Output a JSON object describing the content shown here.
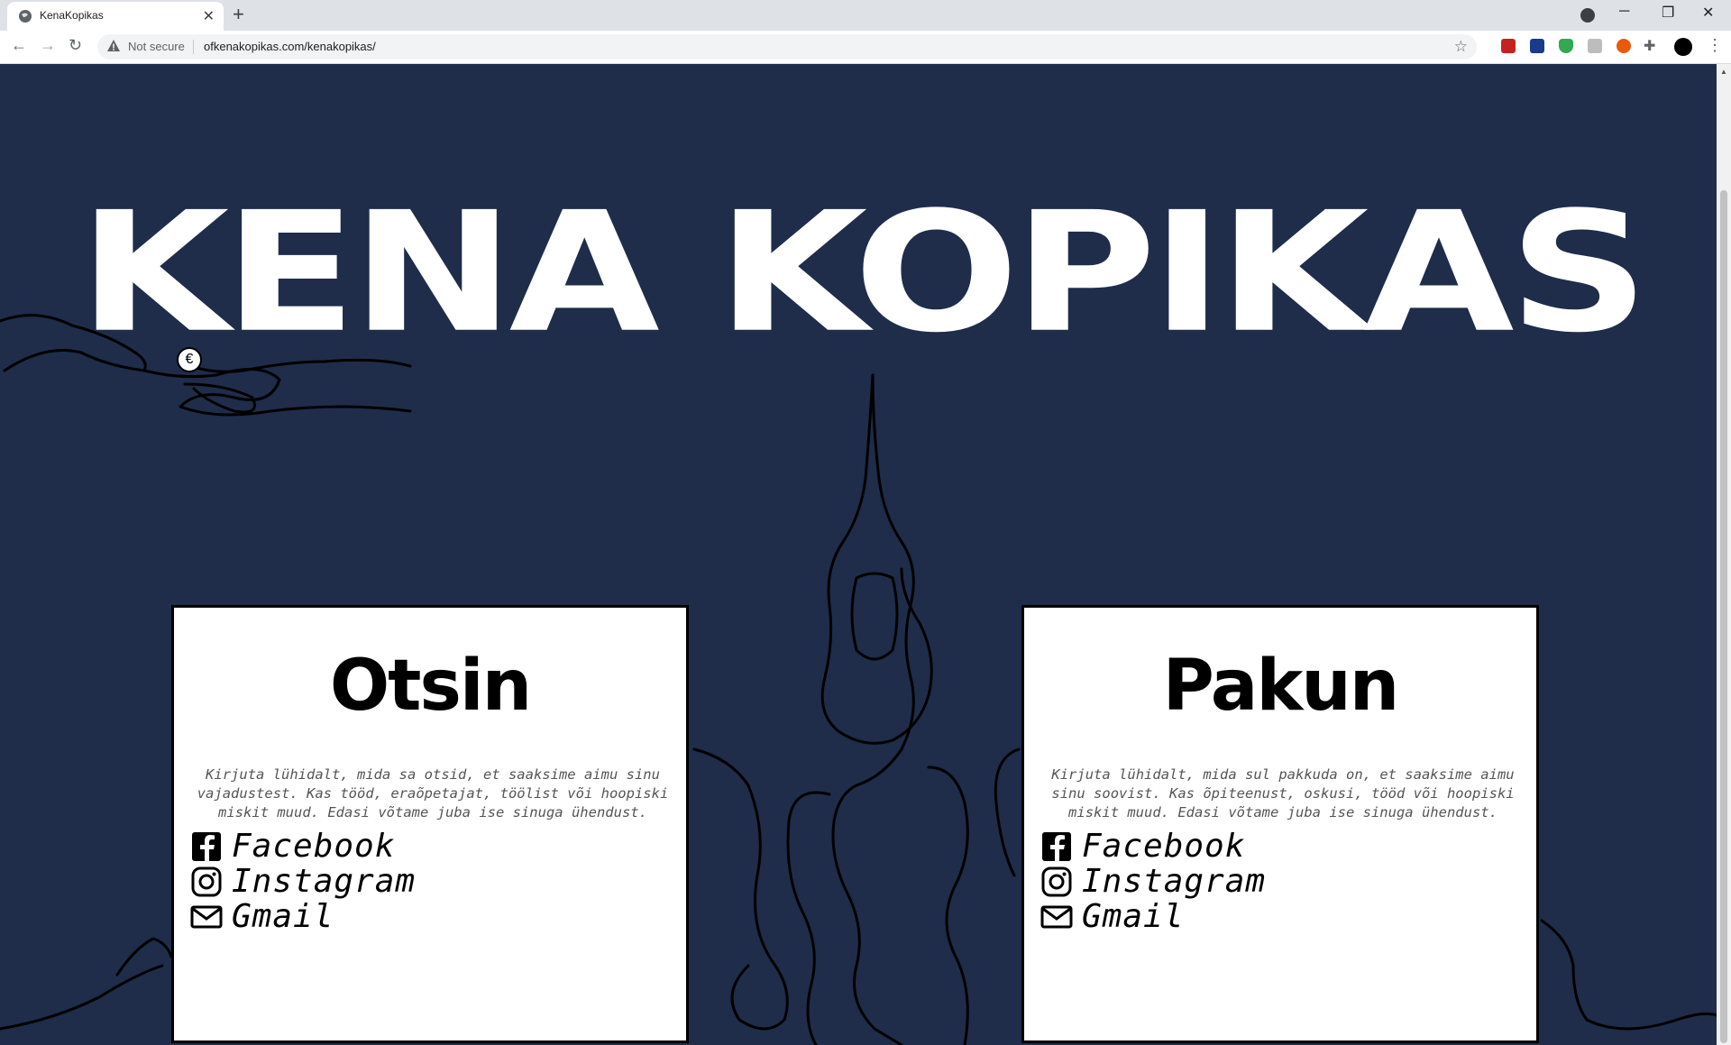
{
  "browser": {
    "tab_title": "KenaKopikas",
    "new_tab": "+",
    "security_label": "Not secure",
    "url": "ofkenakopikas.com/kenakopikas/"
  },
  "page": {
    "hero_title": "KENA KOPIKAS",
    "coin_symbol": "€",
    "cards": [
      {
        "title": "Otsin",
        "description": "Kirjuta lühidalt, mida sa otsid, et saaksime aimu sinu vajadustest. Kas tööd, eraõpetajat, töölist või hoopiski miskit muud. Edasi võtame juba ise sinuga ühendust.",
        "links": [
          "Facebook",
          "Instagram",
          "Gmail"
        ]
      },
      {
        "title": "Pakun",
        "description": "Kirjuta lühidalt, mida sul pakkuda on, et saaksime aimu sinu soovist. Kas õpiteenust, oskusi, tööd või hoopiski miskit muud. Edasi võtame juba ise sinuga ühendust.",
        "links": [
          "Facebook",
          "Instagram",
          "Gmail"
        ]
      }
    ]
  },
  "colors": {
    "background": "#1f2d4b",
    "card": "#ffffff",
    "title": "#ffffff"
  }
}
